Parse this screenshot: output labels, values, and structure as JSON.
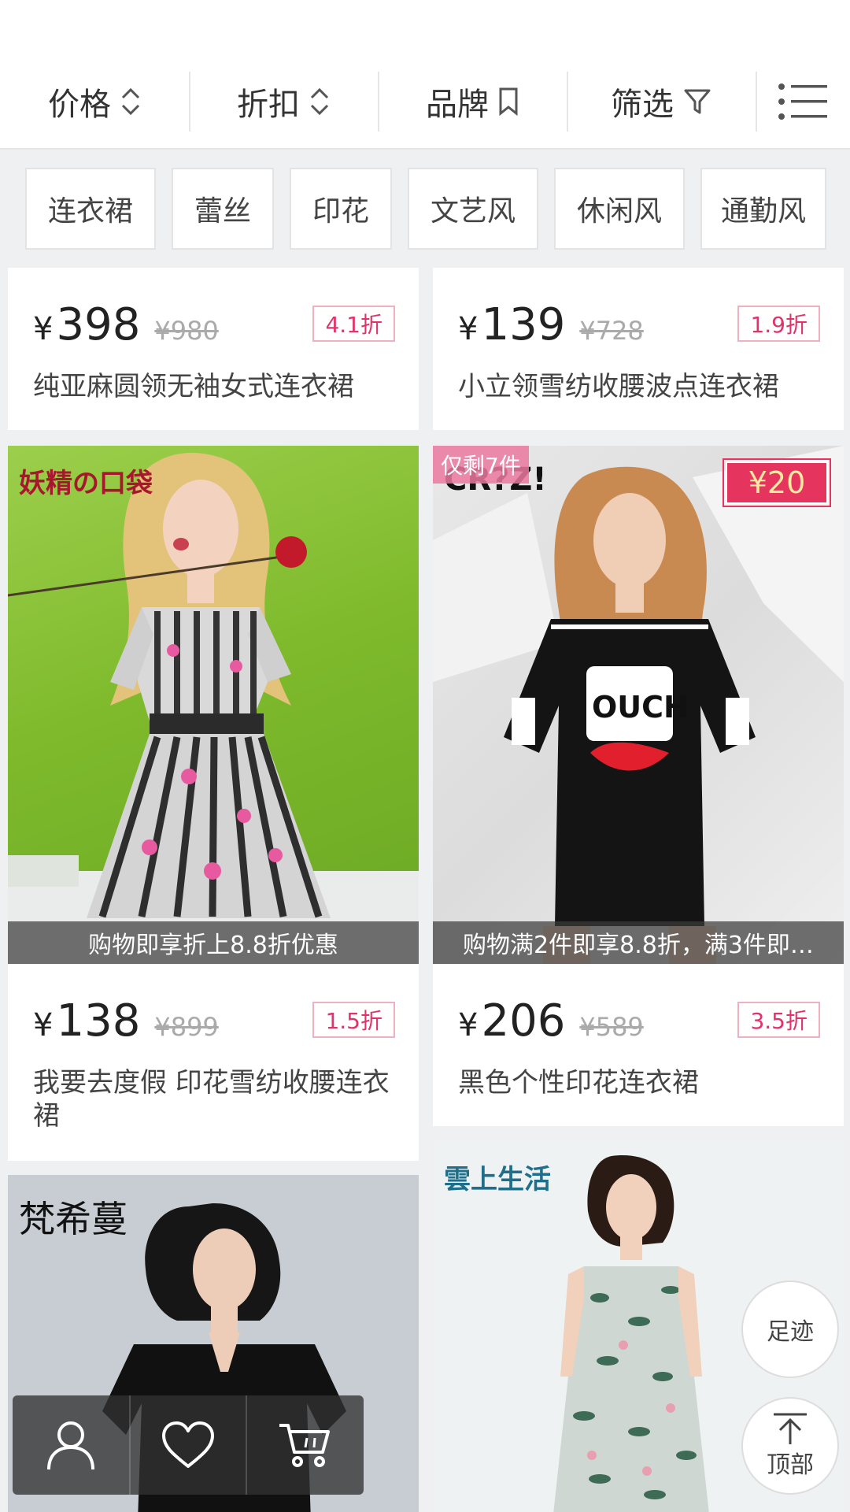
{
  "filters": {
    "price": "价格",
    "discount": "折扣",
    "brand": "品牌",
    "screen": "筛选"
  },
  "tags": [
    "连衣裙",
    "蕾丝",
    "印花",
    "文艺风",
    "休闲风",
    "通勤风"
  ],
  "currency": "¥",
  "products": [
    {
      "price": "398",
      "original": "¥980",
      "discount": "4.1折",
      "title": "纯亚麻圆领无袖女式连衣裙"
    },
    {
      "price": "139",
      "original": "¥728",
      "discount": "1.9折",
      "title": "小立领雪纺收腰波点连衣裙"
    },
    {
      "brand": "妖精の口袋",
      "promo": "购物即享折上8.8折优惠",
      "price": "138",
      "original": "¥899",
      "discount": "1.5折",
      "title": "我要去度假 印花雪纺收腰连衣裙"
    },
    {
      "badge": "仅剩7件",
      "brand": "CR?Z!",
      "coupon": "¥20",
      "promo": "购物满2件即享8.8折，满3件即…",
      "price": "206",
      "original": "¥589",
      "discount": "3.5折",
      "title": "黑色个性印花连衣裙"
    },
    {
      "brand": "梵希蔓"
    },
    {
      "brand": "雲上生活"
    }
  ],
  "floating": {
    "history": "足迹",
    "top": "顶部"
  },
  "icons": {
    "sort": "sort-updown-icon",
    "bookmark": "bookmark-icon",
    "filter": "funnel-icon",
    "menu": "list-menu-icon",
    "user": "user-icon",
    "favorite": "heart-icon",
    "cart": "cart-icon",
    "top": "arrow-up-icon"
  },
  "colors": {
    "accent": "#e0336a",
    "coupon_bg": "#e5345e"
  }
}
